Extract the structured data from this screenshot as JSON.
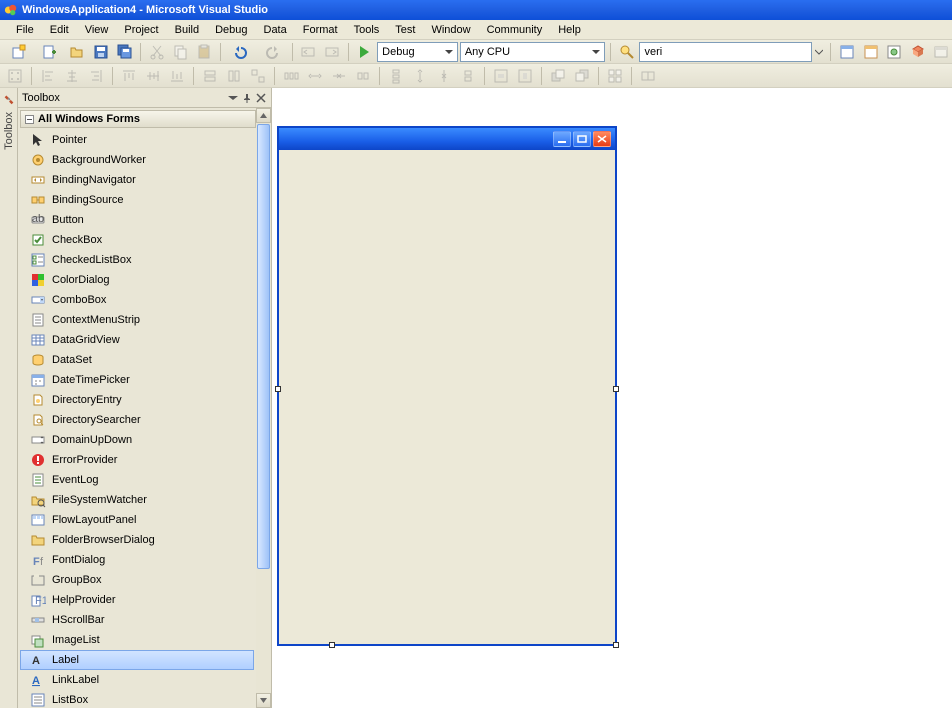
{
  "window": {
    "title": "WindowsApplication4 - Microsoft Visual Studio"
  },
  "menu": {
    "items": [
      "File",
      "Edit",
      "View",
      "Project",
      "Build",
      "Debug",
      "Data",
      "Format",
      "Tools",
      "Test",
      "Window",
      "Community",
      "Help"
    ]
  },
  "toolbar1": {
    "config": "Debug",
    "platform": "Any CPU",
    "search": "veri"
  },
  "side_tab": {
    "label": "Toolbox"
  },
  "toolbox": {
    "title": "Toolbox",
    "category": "All Windows Forms",
    "items": [
      {
        "icon": "pointer",
        "label": "Pointer"
      },
      {
        "icon": "bgworker",
        "label": "BackgroundWorker"
      },
      {
        "icon": "bnav",
        "label": "BindingNavigator"
      },
      {
        "icon": "bsrc",
        "label": "BindingSource"
      },
      {
        "icon": "btn",
        "label": "Button"
      },
      {
        "icon": "chk",
        "label": "CheckBox"
      },
      {
        "icon": "chklist",
        "label": "CheckedListBox"
      },
      {
        "icon": "color",
        "label": "ColorDialog"
      },
      {
        "icon": "combo",
        "label": "ComboBox"
      },
      {
        "icon": "ctxmenu",
        "label": "ContextMenuStrip"
      },
      {
        "icon": "dgv",
        "label": "DataGridView"
      },
      {
        "icon": "ds",
        "label": "DataSet"
      },
      {
        "icon": "dtp",
        "label": "DateTimePicker"
      },
      {
        "icon": "dentry",
        "label": "DirectoryEntry"
      },
      {
        "icon": "dsearch",
        "label": "DirectorySearcher"
      },
      {
        "icon": "updown",
        "label": "DomainUpDown"
      },
      {
        "icon": "err",
        "label": "ErrorProvider"
      },
      {
        "icon": "evlog",
        "label": "EventLog"
      },
      {
        "icon": "fsw",
        "label": "FileSystemWatcher"
      },
      {
        "icon": "flow",
        "label": "FlowLayoutPanel"
      },
      {
        "icon": "folder",
        "label": "FolderBrowserDialog"
      },
      {
        "icon": "font",
        "label": "FontDialog"
      },
      {
        "icon": "group",
        "label": "GroupBox"
      },
      {
        "icon": "help",
        "label": "HelpProvider"
      },
      {
        "icon": "hscroll",
        "label": "HScrollBar"
      },
      {
        "icon": "imglist",
        "label": "ImageList"
      },
      {
        "icon": "label",
        "label": "Label",
        "selected": true
      },
      {
        "icon": "link",
        "label": "LinkLabel"
      },
      {
        "icon": "listbox",
        "label": "ListBox"
      }
    ]
  }
}
